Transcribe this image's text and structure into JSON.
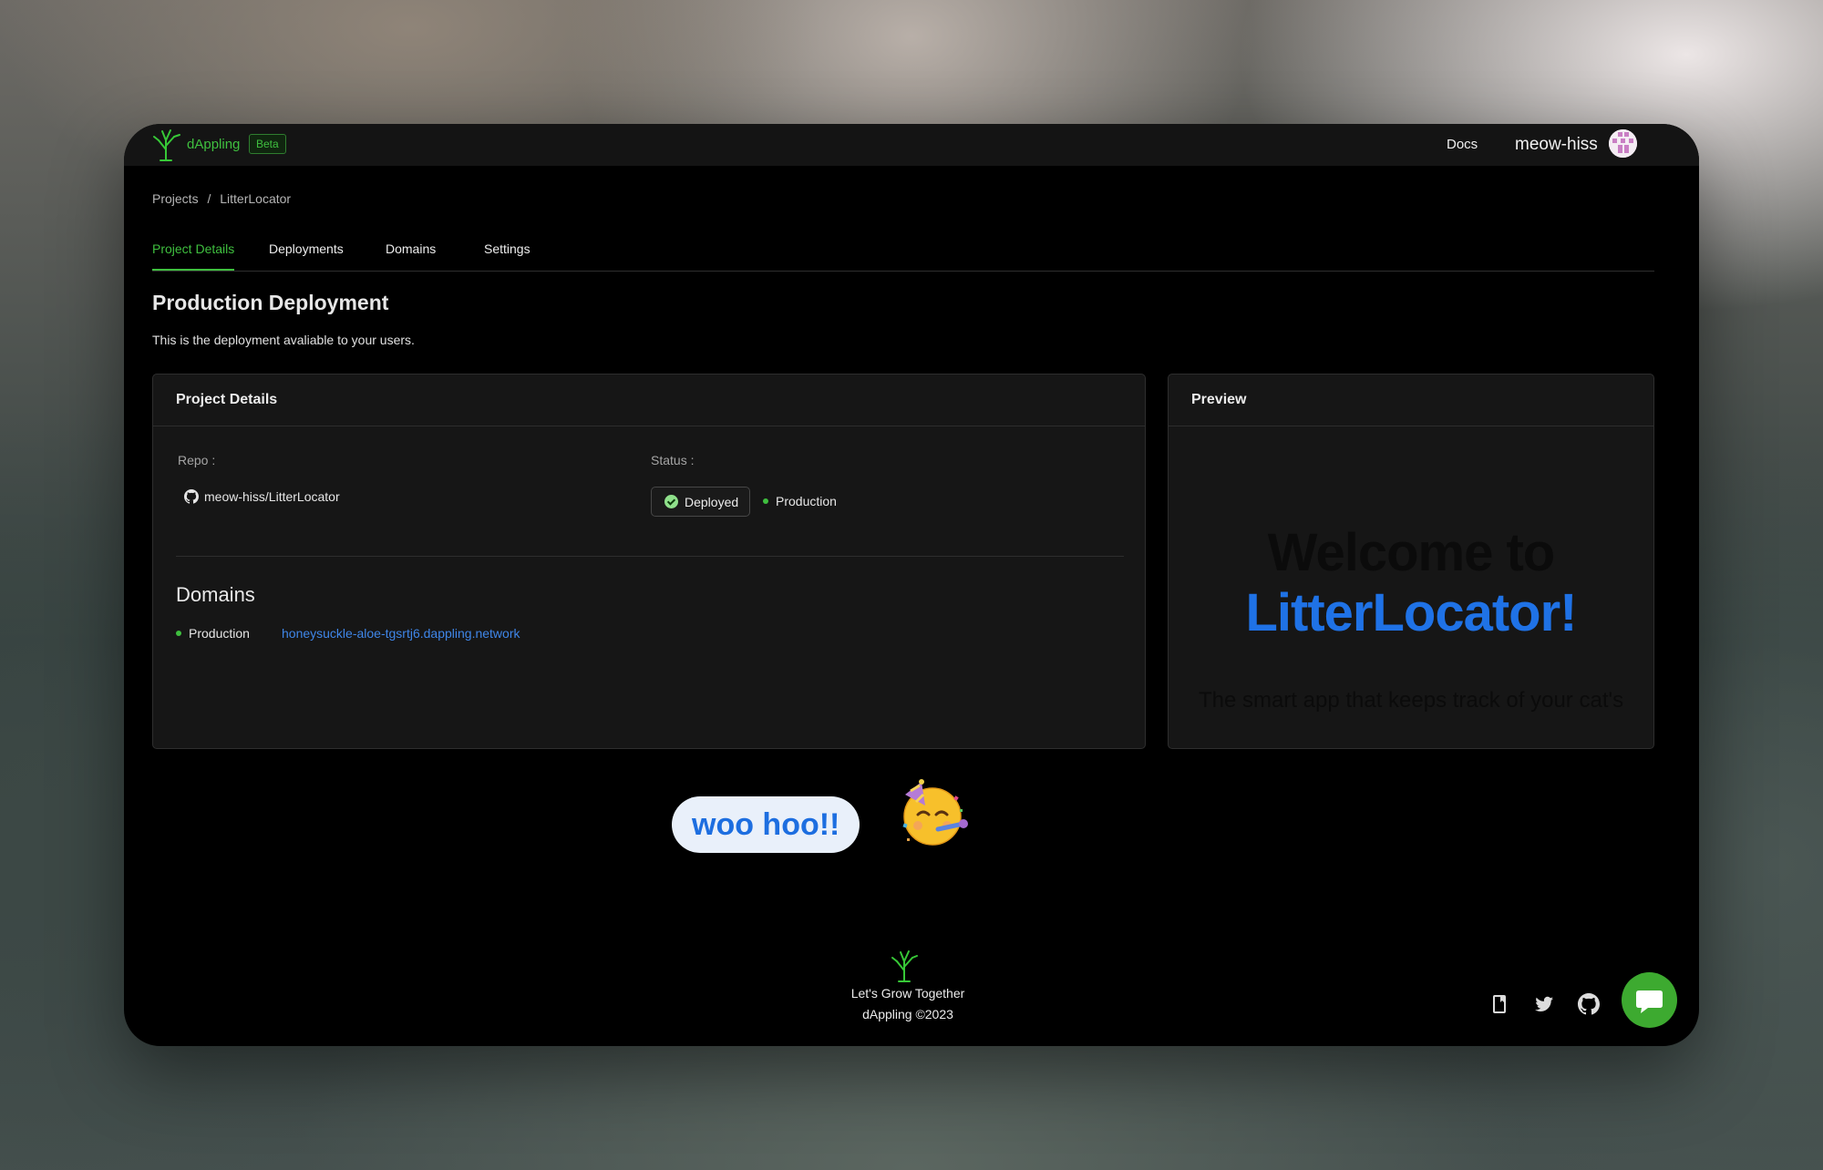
{
  "app": {
    "brand": "dAppling",
    "badge": "Beta",
    "nav_docs": "Docs",
    "username": "meow-hiss"
  },
  "breadcrumb": {
    "items": [
      "Projects",
      "/",
      "LitterLocator"
    ]
  },
  "tabs": [
    {
      "label": "Project Details",
      "active": true
    },
    {
      "label": "Deployments",
      "active": false
    },
    {
      "label": "Domains",
      "active": false
    },
    {
      "label": "Settings",
      "active": false
    }
  ],
  "main": {
    "title": "Production Deployment",
    "subtitle": "This is the deployment avaliable to your users."
  },
  "details_card": {
    "title": "Project Details",
    "repo_label": "Repo :",
    "repo_value": "meow-hiss/LitterLocator",
    "status_label": "Status :",
    "status_badge": "Deployed",
    "environment": "Production",
    "domains_heading": "Domains",
    "domain_env": "Production",
    "domain_url": "honeysuckle-aloe-tgsrtj6.dappling.network"
  },
  "preview_card": {
    "title": "Preview",
    "line1": "Welcome to",
    "line2": "LitterLocator!",
    "line3": "The smart app that keeps track of your cat's"
  },
  "overlay": {
    "bubble_text": "woo hoo!!"
  },
  "footer": {
    "tagline": "Let's Grow Together",
    "copyright": "dAppling ©2023"
  },
  "colors": {
    "accent": "#3fbf3f",
    "link": "#3f86e8",
    "preview_blue": "#1f72e6",
    "chat_button": "#3daa30"
  },
  "icons": [
    "tree-logo-icon",
    "github-icon",
    "check-circle-icon",
    "bookmark-icon",
    "twitter-icon",
    "chat-icon",
    "party-face-emoji"
  ]
}
